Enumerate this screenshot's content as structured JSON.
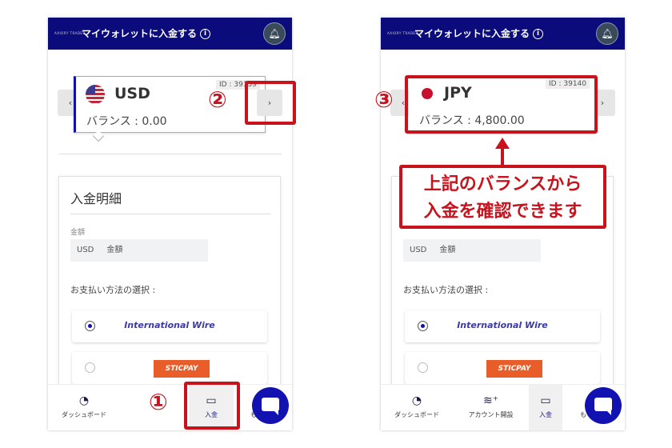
{
  "header": {
    "logo": "AXIORY TRADER",
    "title": "マイウォレットに入金する",
    "info_icon": "info-icon",
    "bell_icon": "bell-icon"
  },
  "left": {
    "wallet": {
      "currency": "USD",
      "flag": "us-flag",
      "balance": "バランス : 0.00",
      "id": "ID : 39139"
    },
    "nav": [
      "ダッシュボード",
      "入金",
      "もっと"
    ]
  },
  "right": {
    "wallet": {
      "currency": "JPY",
      "flag": "jp-flag",
      "balance": "バランス : 4,800.00",
      "id": "ID : 39140"
    },
    "nav": [
      "ダッシュボード",
      "アカウント開設",
      "入金",
      "もっと"
    ]
  },
  "deposit": {
    "title": "入金明細",
    "amount_label": "金額",
    "amount_currency": "USD",
    "amount_placeholder": "金額",
    "payment_label": "お支払い方法の選択 :",
    "options": [
      {
        "label": "International Wire",
        "selected": true
      },
      {
        "label": "STICPAY",
        "selected": false
      }
    ]
  },
  "chevrons": {
    "prev": "‹",
    "next": "›"
  },
  "annotations": {
    "step1": "①",
    "step2": "②",
    "step3": "③",
    "callout_line1": "上記のバランスから",
    "callout_line2": "入金を確認できます",
    "color": "#c8121c"
  },
  "colors": {
    "header": "#0b0b7c",
    "accent": "#1212b0",
    "sticpay": "#e85d2a"
  }
}
